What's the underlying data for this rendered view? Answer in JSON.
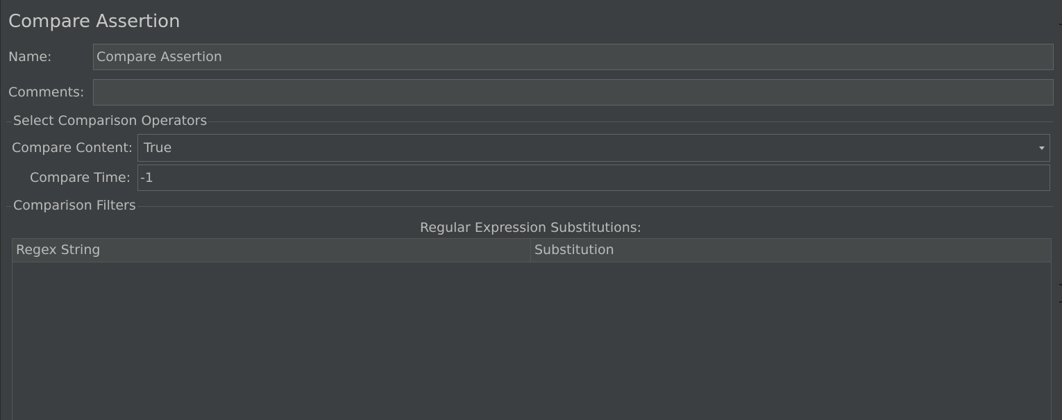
{
  "panel": {
    "title": "Compare Assertion"
  },
  "name_field": {
    "label": "Name:",
    "value": "Compare Assertion"
  },
  "comments_field": {
    "label": "Comments:",
    "value": ""
  },
  "operators": {
    "section_title": "Select Comparison Operators",
    "compare_content": {
      "label": "Compare Content:",
      "selected": "True"
    },
    "compare_time": {
      "label": "Compare Time:",
      "value": "-1"
    }
  },
  "filters": {
    "section_title": "Comparison Filters",
    "table_caption": "Regular Expression Substitutions:",
    "columns": [
      "Regex String",
      "Substitution"
    ],
    "rows": []
  },
  "colors": {
    "background": "#3c3f41",
    "field_background": "#45494a",
    "border": "#646464",
    "text": "#bbbbbb"
  }
}
